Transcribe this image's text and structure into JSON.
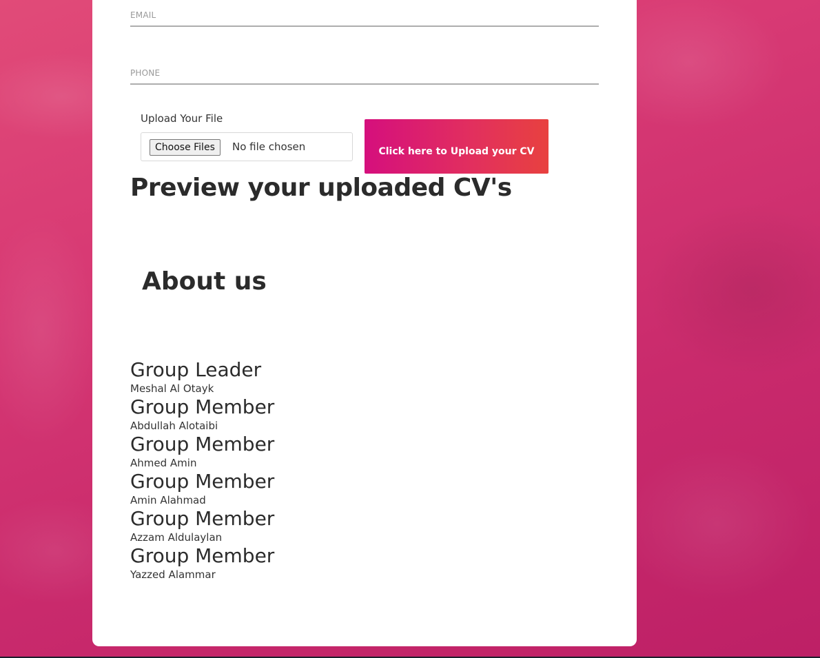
{
  "form": {
    "email_label": "EMAIL",
    "phone_label": "PHONE",
    "upload_label": "Upload Your File",
    "choose_files_label": "Choose Files",
    "no_file_text": "No file chosen",
    "upload_button_label": "Click here to Upload your CV"
  },
  "preview": {
    "title": "Preview your uploaded CV's"
  },
  "about": {
    "title": "About us",
    "members": [
      {
        "role": "Group Leader",
        "name": "Meshal Al Otayk"
      },
      {
        "role": "Group Member",
        "name": "Abdullah Alotaibi"
      },
      {
        "role": "Group Member",
        "name": "Ahmed Amin"
      },
      {
        "role": "Group Member",
        "name": "Amin Alahmad"
      },
      {
        "role": "Group Member",
        "name": "Azzam Aldulaylan"
      },
      {
        "role": "Group Member",
        "name": "Yazzed Alammar"
      }
    ]
  },
  "colors": {
    "background": "#d9306e",
    "button_gradient_start": "#d50f7d",
    "button_gradient_end": "#e8413f",
    "card": "#ffffff",
    "field_underline": "#adadad"
  }
}
